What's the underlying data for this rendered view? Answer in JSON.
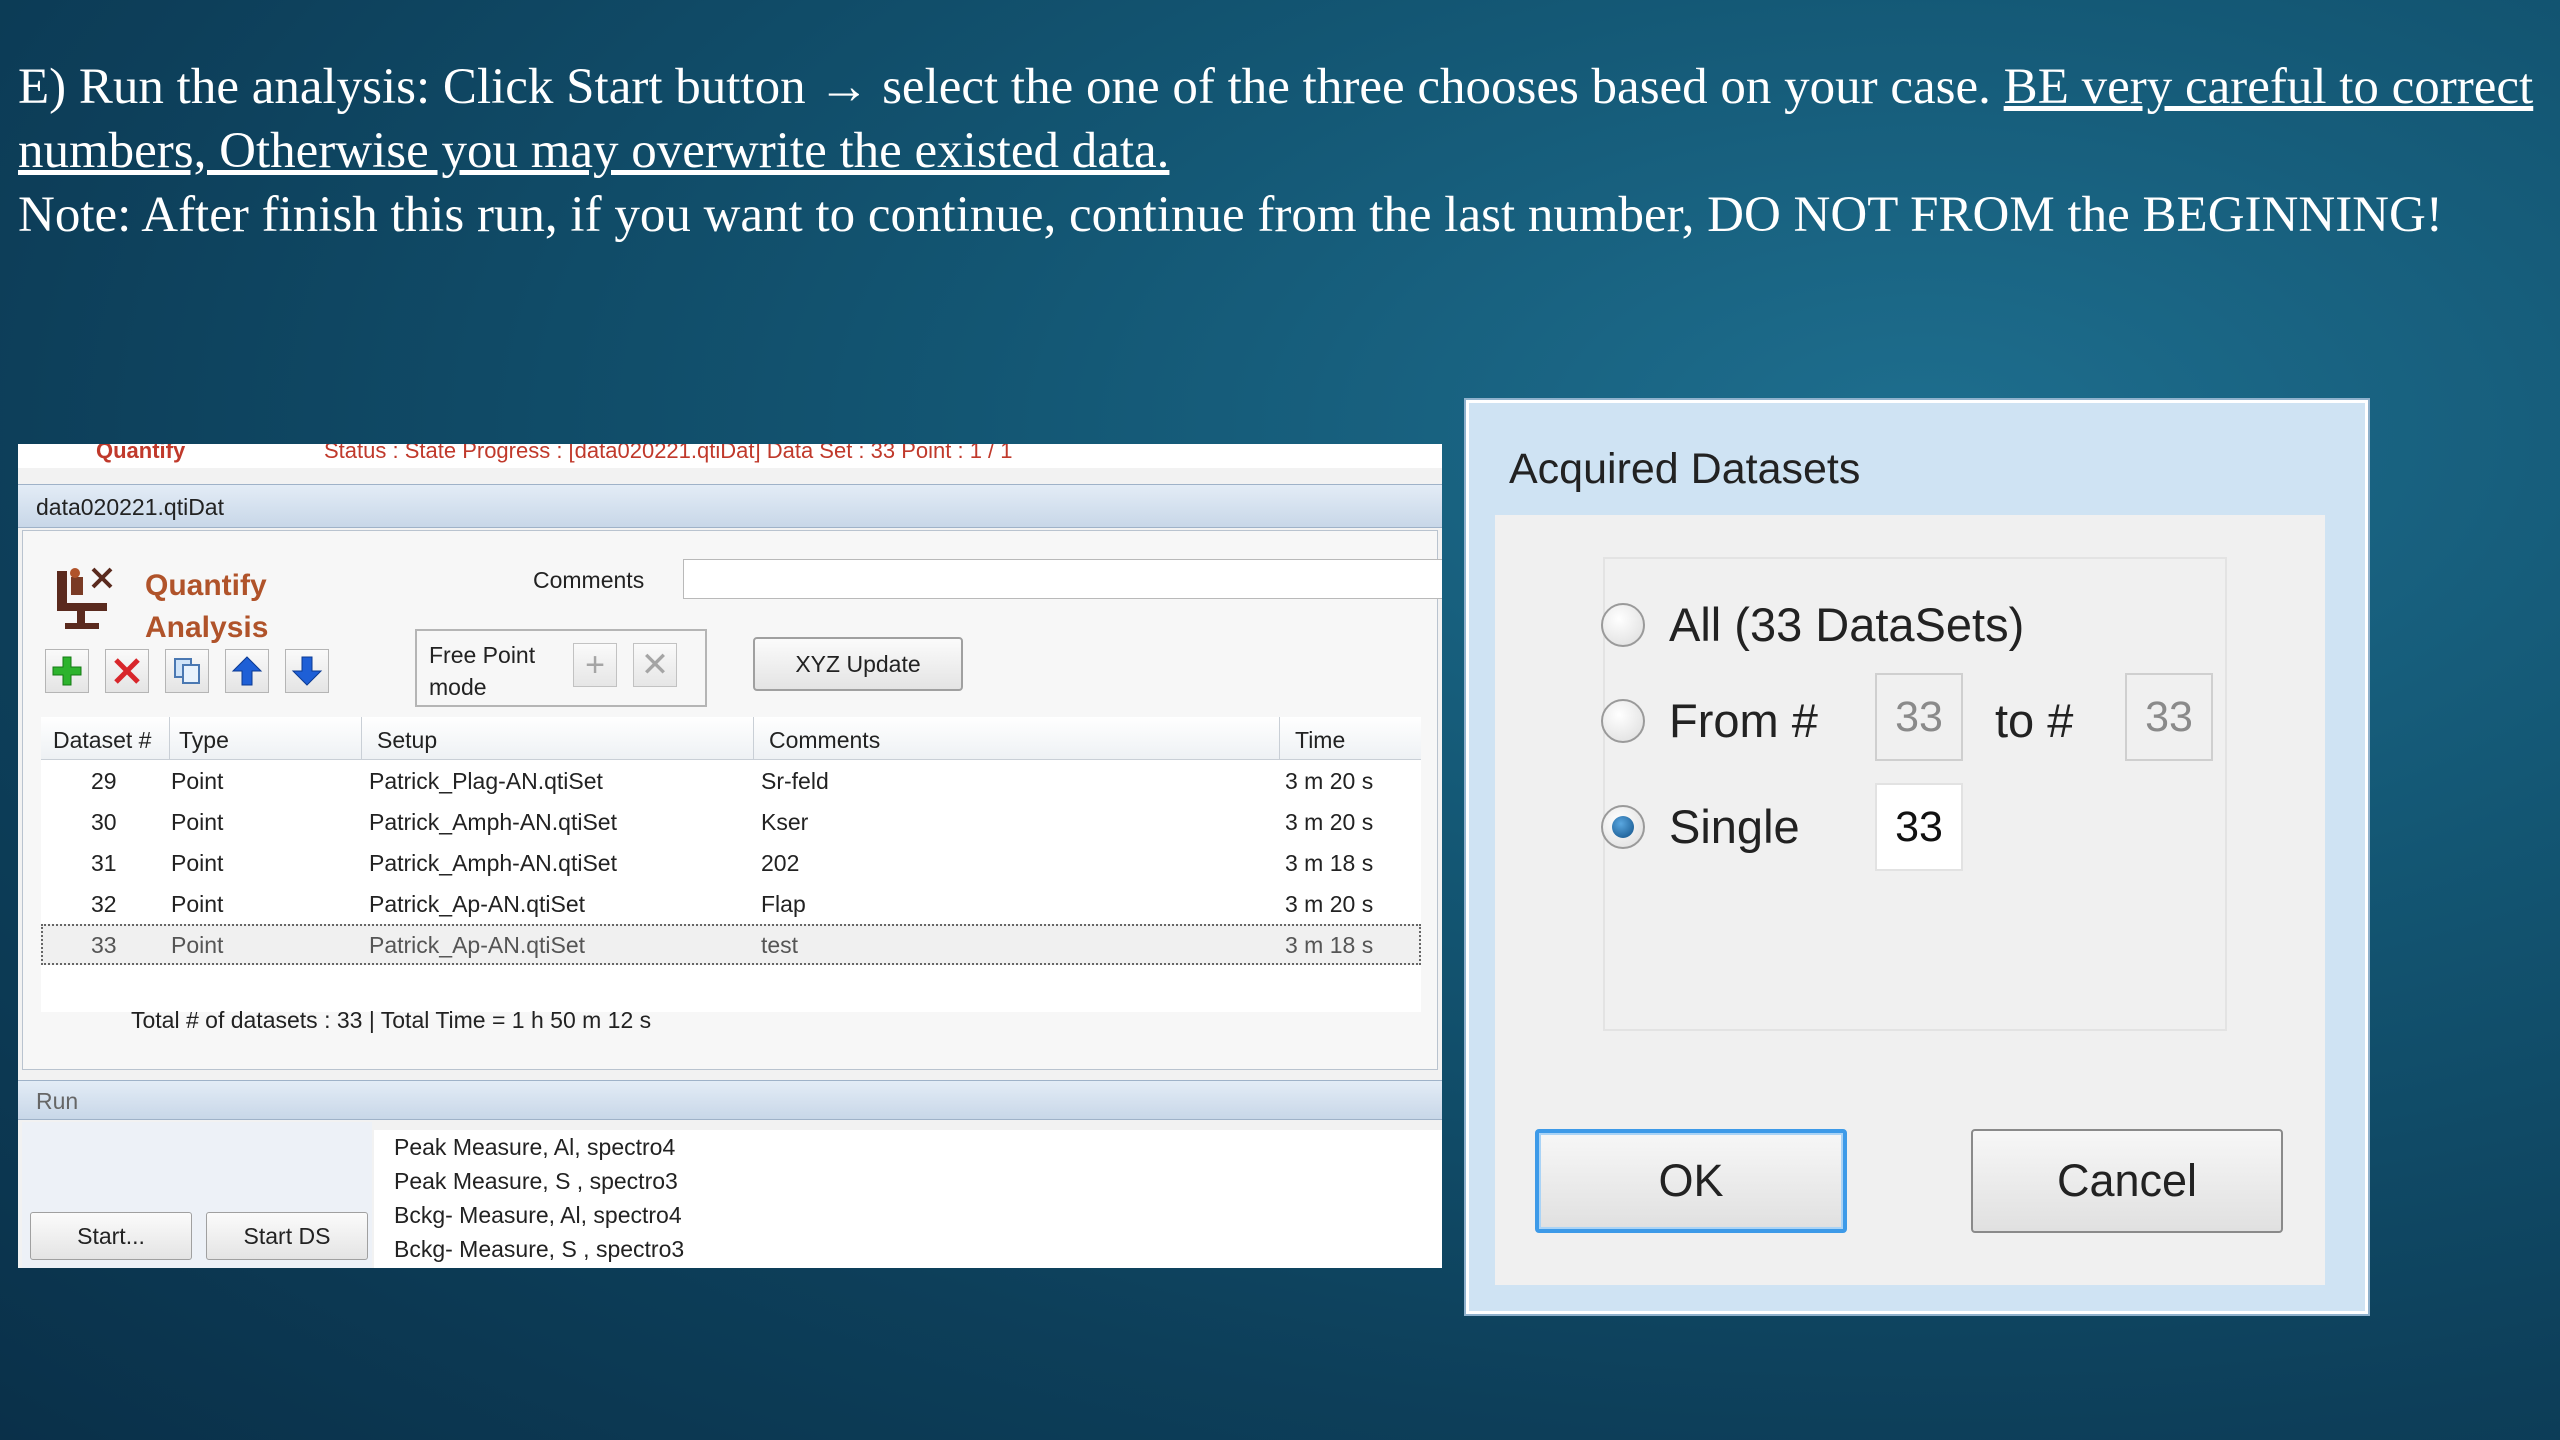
{
  "slide": {
    "line1_a": "E) Run the analysis: Click Start button → select the one of the three chooses based on your case.  ",
    "line1_b": "BE very careful to correct numbers, Otherwise you may overwrite the existed data.",
    "line2": "Note: After finish this run, if you want to continue, continue from the last number, DO NOT FROM the BEGINNING!"
  },
  "app": {
    "status_quantity": "Quantify",
    "status_text": "Status : State  Progress : [data020221.qtiDat]  Data Set : 33 Point : 1 / 1",
    "panel_title": "data020221.qtiDat",
    "qa_title_line1": "Quantify",
    "qa_title_line2": "Analysis",
    "comments_label": "Comments",
    "comments_value": "",
    "free_point_label": "Free Point mode",
    "xyz_button": "XYZ Update",
    "toolbar_icons": [
      "add-icon",
      "delete-icon",
      "copy-icon",
      "move-up-icon",
      "move-down-icon"
    ],
    "table": {
      "headers": [
        "Dataset #",
        "Type",
        "Setup",
        "Comments",
        "Time"
      ],
      "rows": [
        {
          "dataset": "29",
          "type": "Point",
          "setup": "Patrick_Plag-AN.qtiSet",
          "comments": "Sr-feld",
          "time": "3 m 20 s"
        },
        {
          "dataset": "30",
          "type": "Point",
          "setup": "Patrick_Amph-AN.qtiSet",
          "comments": "Kser",
          "time": "3 m 20 s"
        },
        {
          "dataset": "31",
          "type": "Point",
          "setup": "Patrick_Amph-AN.qtiSet",
          "comments": "202",
          "time": "3 m 18 s"
        },
        {
          "dataset": "32",
          "type": "Point",
          "setup": "Patrick_Ap-AN.qtiSet",
          "comments": "Flap",
          "time": "3 m 20 s"
        },
        {
          "dataset": "33",
          "type": "Point",
          "setup": "Patrick_Ap-AN.qtiSet",
          "comments": "test",
          "time": "3 m 18 s"
        }
      ],
      "totals": "Total # of datasets : 33  | Total Time = 1 h 50 m 12 s"
    },
    "run": {
      "title": "Run",
      "start_button": "Start...",
      "start_ds_button": "Start DS",
      "items": [
        "Peak Measure, Al, spectro4",
        "Peak Measure, S , spectro3",
        "Bckg- Measure, Al, spectro4",
        "Bckg- Measure, S , spectro3"
      ]
    }
  },
  "dialog": {
    "title": "Acquired Datasets",
    "option_all": "All (33 DataSets)",
    "option_from": "From #",
    "option_to": "to #",
    "option_single": "Single",
    "from_value": "33",
    "to_value": "33",
    "single_value": "33",
    "selected_option": "Single",
    "ok_button": "OK",
    "cancel_button": "Cancel"
  }
}
